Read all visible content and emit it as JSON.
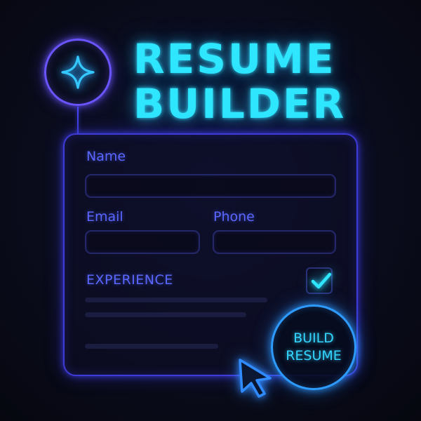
{
  "header": {
    "title_line1": "RESUME",
    "title_line2": "BUILDER",
    "badge_icon": "sparkle-icon"
  },
  "form": {
    "name_label": "Name",
    "name_value": "",
    "email_label": "Email",
    "email_value": "",
    "phone_label": "Phone",
    "phone_value": "",
    "experience_label": "EXPERIENCE",
    "experience_checked": true
  },
  "build_button": {
    "line1": "BUILD",
    "line2": "RESUME"
  },
  "icons": {
    "badge": "sparkle-icon",
    "checkbox": "checkmark-icon",
    "pointer": "mouse-pointer-icon"
  },
  "colors": {
    "accent_cyan": "#2fe6ff",
    "accent_violet": "#5a66ff",
    "panel_border": "#3f3bd9",
    "button_border": "#2d9bff",
    "background": "#090b16"
  }
}
